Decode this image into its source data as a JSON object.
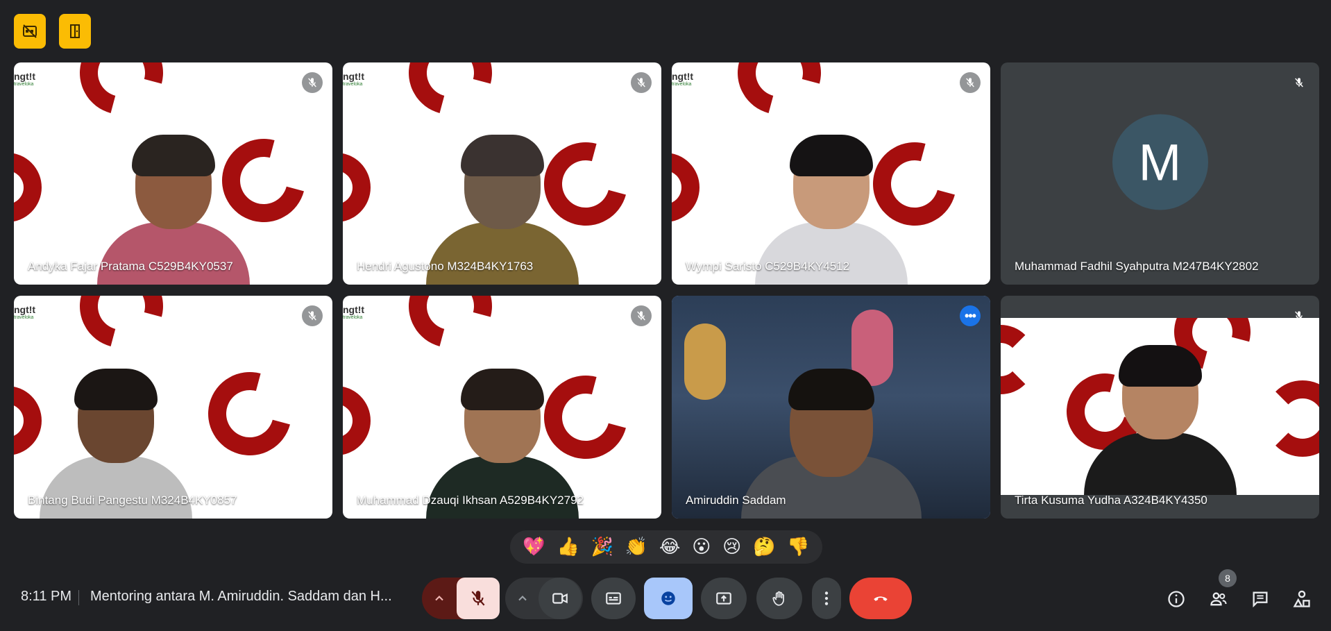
{
  "top_buttons": [
    {
      "icon": "closed-caption-off-icon"
    },
    {
      "icon": "door-icon"
    }
  ],
  "participants": [
    {
      "name": "Andyka Fajar Pratama C529B4KY0537",
      "muted": true,
      "type": "video"
    },
    {
      "name": "Hendri Agustono M324B4KY1763",
      "muted": true,
      "type": "video"
    },
    {
      "name": "Wympi Saristo C529B4KY4512",
      "muted": true,
      "type": "video"
    },
    {
      "name": "Muhammad Fadhil Syahputra M247B4KY2802",
      "muted": true,
      "type": "avatar",
      "initial": "M"
    },
    {
      "name": "Bintang Budi Pangestu M324B4KY0857",
      "muted": true,
      "type": "video"
    },
    {
      "name": "Muhammad Dzauqi Ikhsan A529B4KY2792",
      "muted": true,
      "type": "video"
    },
    {
      "name": "Amiruddin Saddam",
      "muted": false,
      "type": "video",
      "active": true
    },
    {
      "name": "Tirta Kusuma Yudha A324B4KY4350",
      "muted": true,
      "type": "video"
    }
  ],
  "logo": {
    "brand": "ngt!t",
    "sub": "traveloka"
  },
  "reactions": [
    "💖",
    "👍",
    "🎉",
    "👏",
    "😂",
    "😮",
    "😢",
    "🤔",
    "👎"
  ],
  "footer": {
    "time": "8:11 PM",
    "meeting_title": "Mentoring antara M. Amiruddin. Saddam dan H...",
    "people_count": "8"
  },
  "colors": {
    "background": "#202124",
    "tile_dark": "#3c4043",
    "accent_blue": "#8ab4f8",
    "end_call_red": "#ea4335",
    "mic_muted_bg": "#f9dedc",
    "mic_muted_dark": "#5c1a16",
    "yellow": "#fbbc04",
    "avatar_bg": "#3b5665"
  }
}
